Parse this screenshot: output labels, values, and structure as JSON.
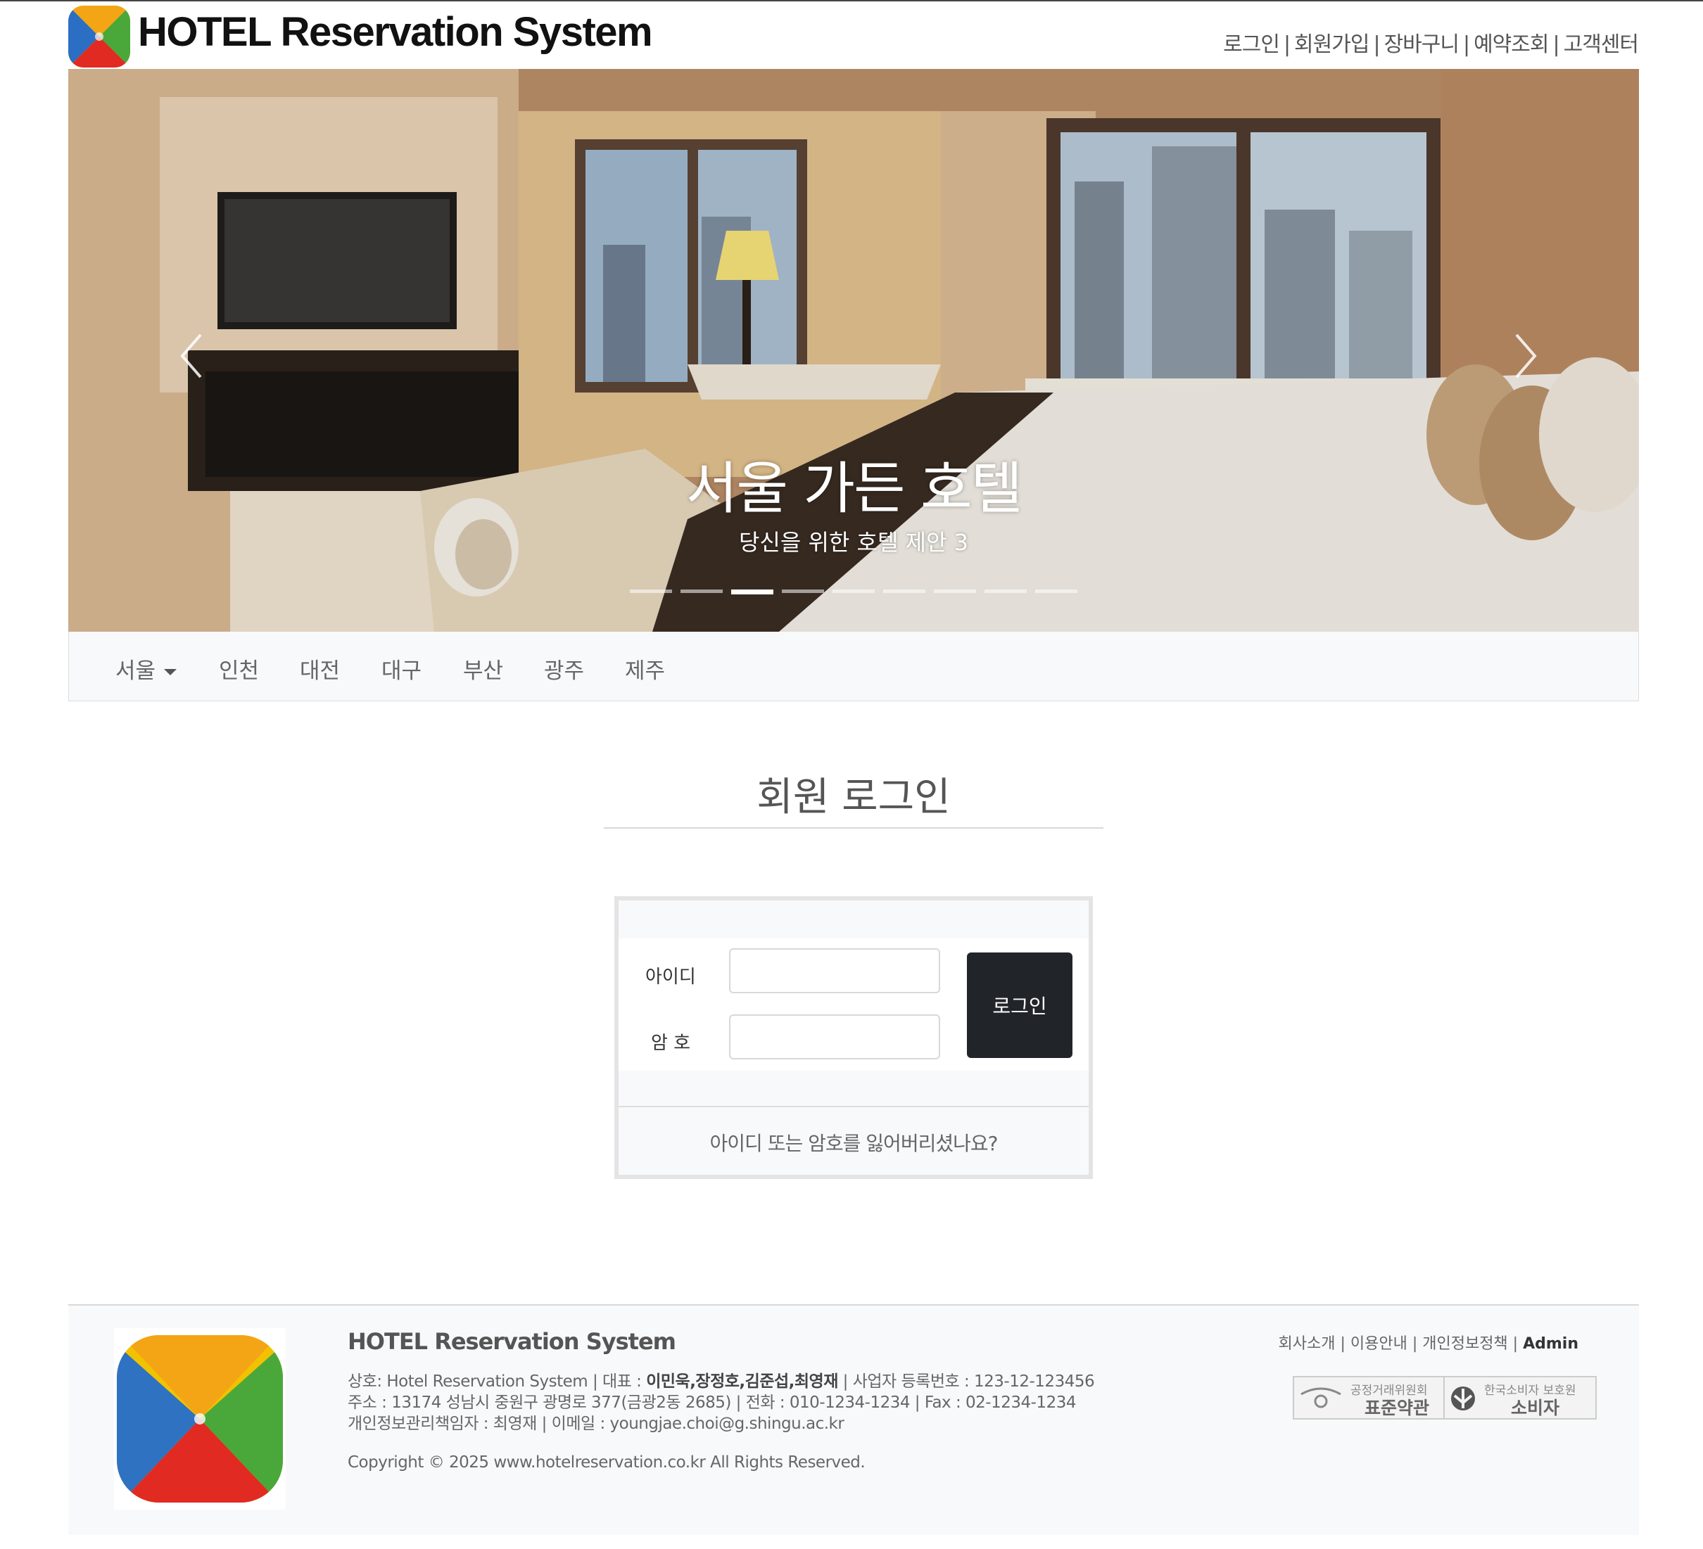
{
  "header": {
    "brand": "HOTEL Reservation System",
    "links": [
      "로그인",
      "회원가입",
      "장바구니",
      "예약조회",
      "고객센터"
    ],
    "separator": "|"
  },
  "carousel": {
    "title": "서울 가든 호텔",
    "subtitle": "당신을 위한 호텔 제안 3",
    "slide_count": 9,
    "active_index": 2
  },
  "nav": {
    "items": [
      "서울",
      "인천",
      "대전",
      "대구",
      "부산",
      "광주",
      "제주"
    ]
  },
  "login": {
    "title": "회원 로그인",
    "id_label": "아이디",
    "pw_label": "암 호",
    "id_value": "",
    "pw_value": "",
    "button": "로그인",
    "forgot": "아이디 또는 암호를 잃어버리셨나요?"
  },
  "footer": {
    "title": "HOTEL Reservation System",
    "line1_prefix": "상호: Hotel Reservation System | 대표 : ",
    "line1_bold": "이민욱,장정호,김준섭,최영재",
    "line1_suffix": " | 사업자 등록번호 : 123-12-123456",
    "line2": "주소 : 13174 성남시 중원구 광명로 377(금광2동 2685) | 전화 : 010-1234-1234 | Fax : 02-1234-1234",
    "line3": "개인정보관리책임자 : 최영재 | 이메일 : youngjae.choi@g.shingu.ac.kr",
    "copyright": "Copyright © 2025 www.hotelreservation.co.kr   All Rights Reserved.",
    "links": [
      "회사소개",
      "이용안내",
      "개인정보정책",
      "Admin"
    ],
    "badge1_small": "공정거래위원회",
    "badge1_big": "표준약관",
    "badge2_small": "한국소비자 보호원",
    "badge2_big": "소비자"
  }
}
